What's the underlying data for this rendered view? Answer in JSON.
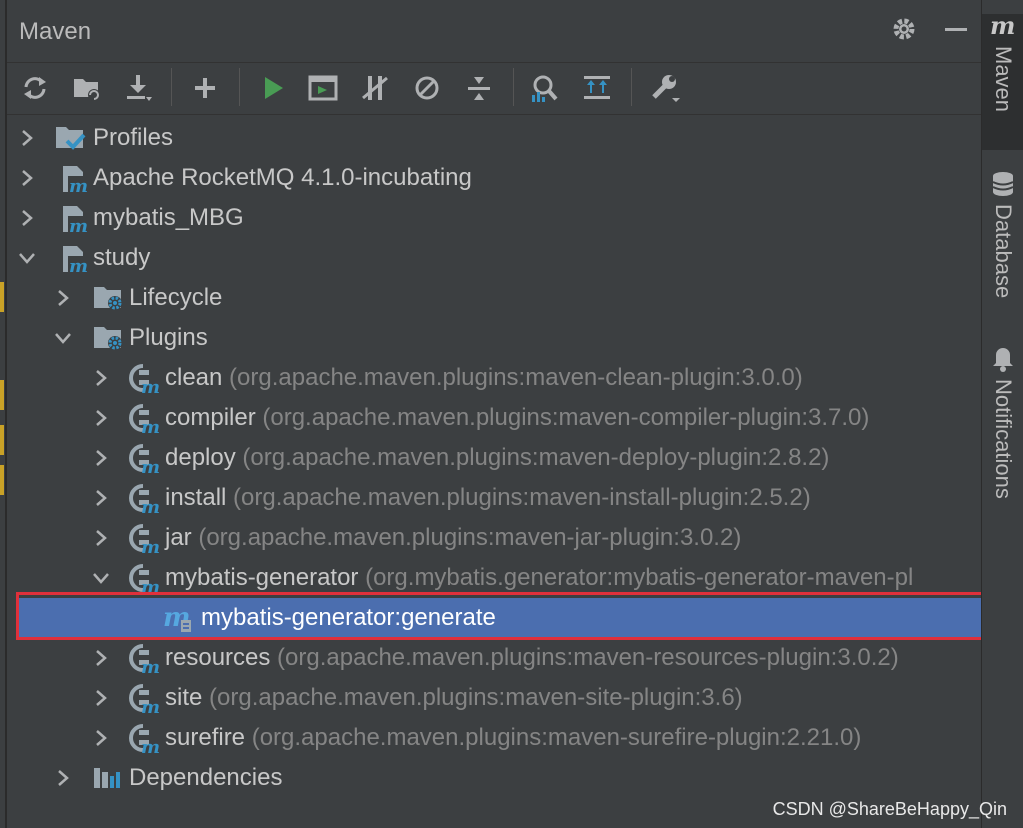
{
  "panel": {
    "title": "Maven"
  },
  "toolbar": {
    "buttons": [
      "reload-icon",
      "add-folder-icon",
      "download-icon",
      "plus-icon",
      "run-icon",
      "terminal-icon",
      "toggle-offline-icon",
      "skip-tests-icon",
      "collapse-icon",
      "analyze-icon",
      "show-deps-icon",
      "wrench-icon"
    ]
  },
  "tree": {
    "profiles": "Profiles",
    "rocketmq": "Apache RocketMQ 4.1.0-incubating",
    "mybatis_mbg": "mybatis_MBG",
    "study": "study",
    "lifecycle": "Lifecycle",
    "plugins": "Plugins",
    "plugin_items": [
      {
        "name": "clean",
        "desc": "(org.apache.maven.plugins:maven-clean-plugin:3.0.0)"
      },
      {
        "name": "compiler",
        "desc": "(org.apache.maven.plugins:maven-compiler-plugin:3.7.0)"
      },
      {
        "name": "deploy",
        "desc": "(org.apache.maven.plugins:maven-deploy-plugin:2.8.2)"
      },
      {
        "name": "install",
        "desc": "(org.apache.maven.plugins:maven-install-plugin:2.5.2)"
      },
      {
        "name": "jar",
        "desc": "(org.apache.maven.plugins:maven-jar-plugin:3.0.2)"
      },
      {
        "name": "mybatis-generator",
        "desc": "(org.mybatis.generator:mybatis-generator-maven-pl"
      },
      {
        "name": "resources",
        "desc": "(org.apache.maven.plugins:maven-resources-plugin:3.0.2)"
      },
      {
        "name": "site",
        "desc": "(org.apache.maven.plugins:maven-site-plugin:3.6)"
      },
      {
        "name": "surefire",
        "desc": "(org.apache.maven.plugins:maven-surefire-plugin:2.21.0)"
      }
    ],
    "goal": "mybatis-generator:generate",
    "dependencies": "Dependencies"
  },
  "sidebar": {
    "maven": "Maven",
    "database": "Database",
    "notifications": "Notifications"
  },
  "watermark": "CSDN @ShareBeHappy_Qin",
  "colors": {
    "accent_green": "#499c54",
    "maven_blue": "#3592c4",
    "selection": "#4b6eaf",
    "highlight": "#e0303b"
  }
}
